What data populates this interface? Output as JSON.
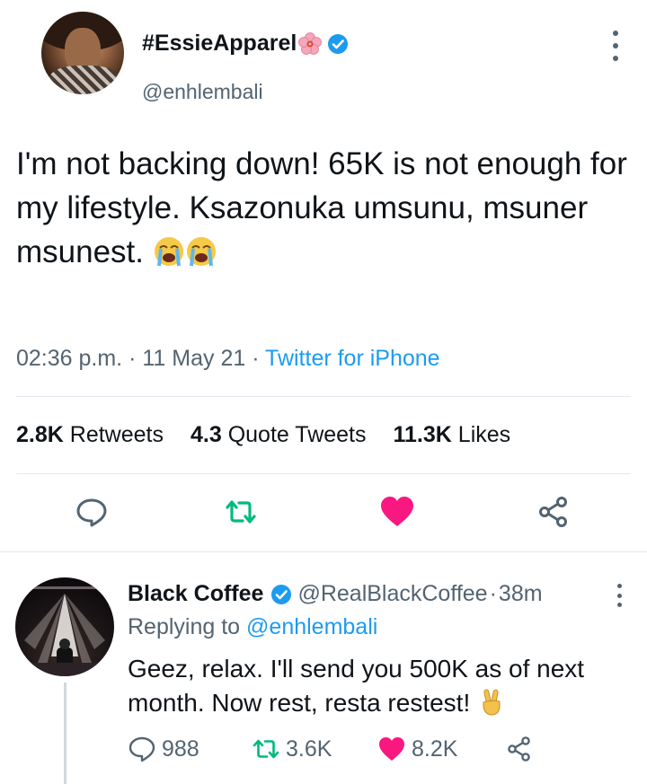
{
  "tweet": {
    "author_name": "#EssieApparel",
    "author_handle": "@enhlembali",
    "text": "I'm not backing down! 65K is not enough for my lifestyle. Ksazonuka umsunu, msuner msunest.",
    "time": "02:36 p.m.",
    "date": "11 May 21",
    "source": "Twitter for iPhone",
    "separator": "·"
  },
  "stats": {
    "retweets_count": "2.8K",
    "retweets_label": "Retweets",
    "quotes_count": "4.3",
    "quotes_label": "Quote Tweets",
    "likes_count": "11.3K",
    "likes_label": "Likes"
  },
  "colors": {
    "accent": "#1d9bf0",
    "retweet": "#00ba7c",
    "like": "#f91880",
    "muted": "#536471"
  },
  "reply": {
    "author_name": "Black Coffee",
    "author_handle": "@RealBlackCoffee",
    "separator": "·",
    "time_ago": "38m",
    "replying_prefix": "Replying to",
    "replying_to": "@enhlembali",
    "text": "Geez, relax. I'll send you 500K as of next month. Now rest, resta restest!",
    "reply_count": "988",
    "retweet_count": "3.6K",
    "like_count": "8.2K"
  }
}
